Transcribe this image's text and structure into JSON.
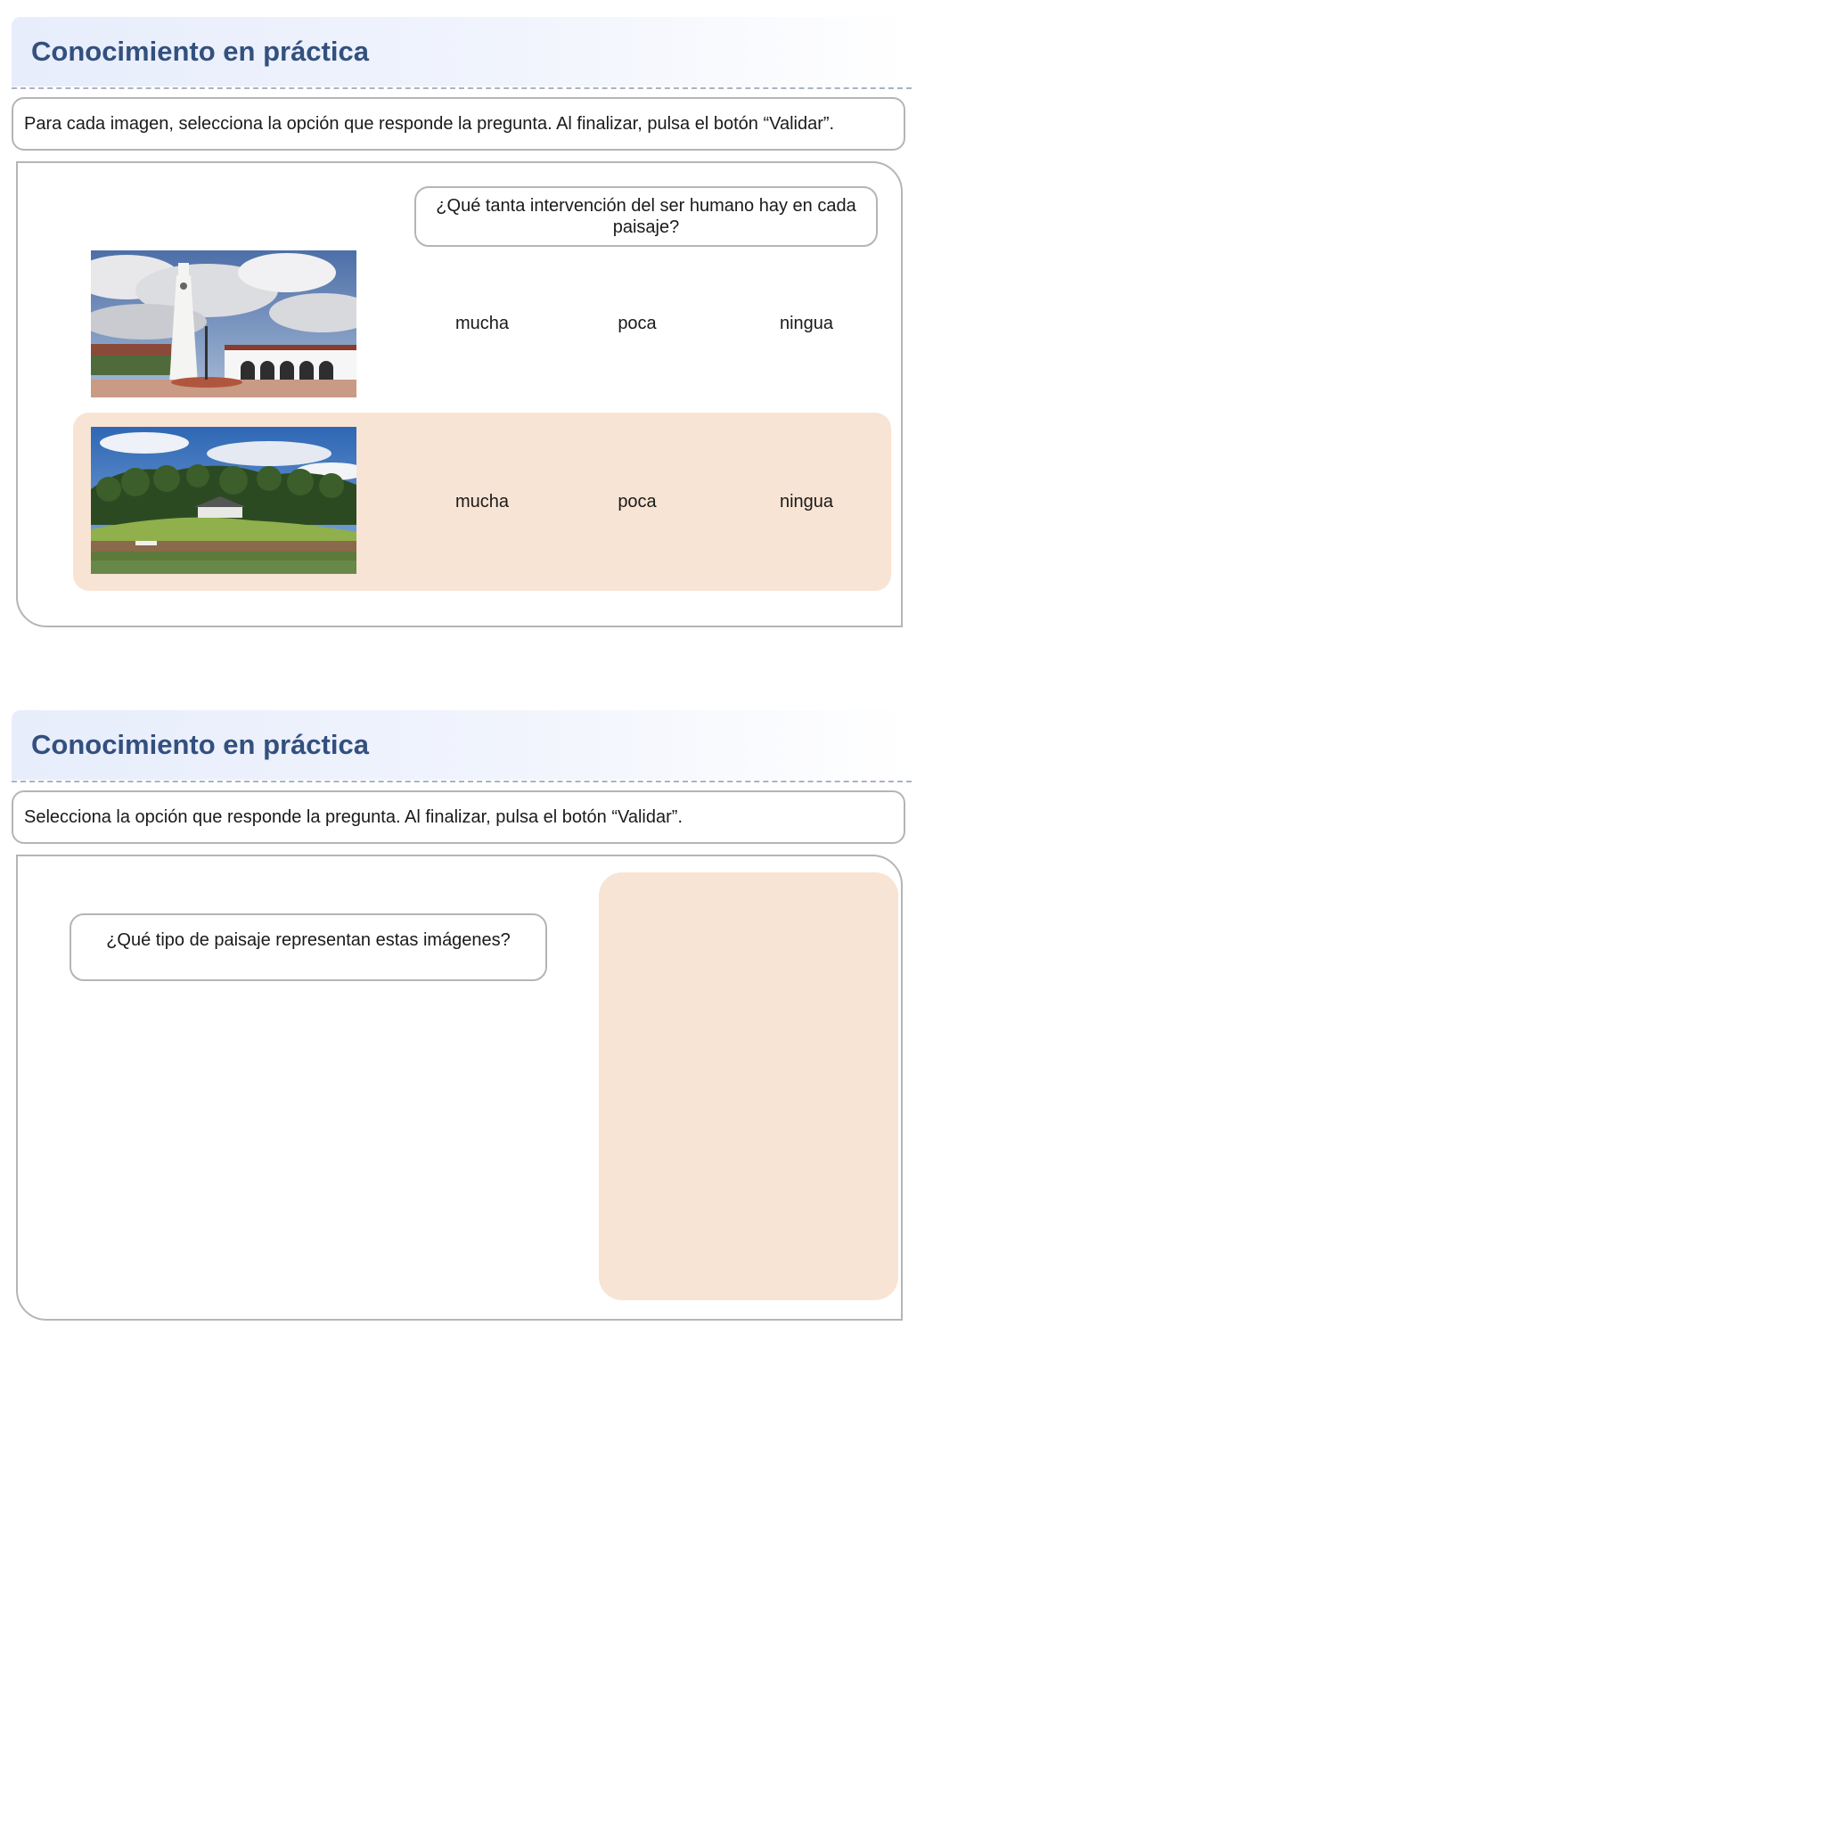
{
  "activity1": {
    "title": "Conocimiento en práctica",
    "instructions": "Para cada imagen, selecciona la opción que responde la pregunta. Al finalizar, pulsa el botón “Validar”.",
    "question": "¿Qué tanta intervención del ser humano hay en cada paisaje?",
    "rows": [
      {
        "image": "town-church-tower-photo",
        "options": [
          "mucha",
          "poca",
          "ningua"
        ]
      },
      {
        "image": "forest-lake-house-photo",
        "options": [
          "mucha",
          "poca",
          "ningua"
        ]
      }
    ]
  },
  "activity2": {
    "title": "Conocimiento en práctica",
    "instructions": "Selecciona la opción que responde la pregunta. Al finalizar, pulsa el botón “Validar”.",
    "question": "¿Qué tipo de paisaje representan estas imágenes?"
  },
  "colors": {
    "title": "#33507e",
    "highlight": "#f8e4d4",
    "border": "#b5b5b5"
  }
}
